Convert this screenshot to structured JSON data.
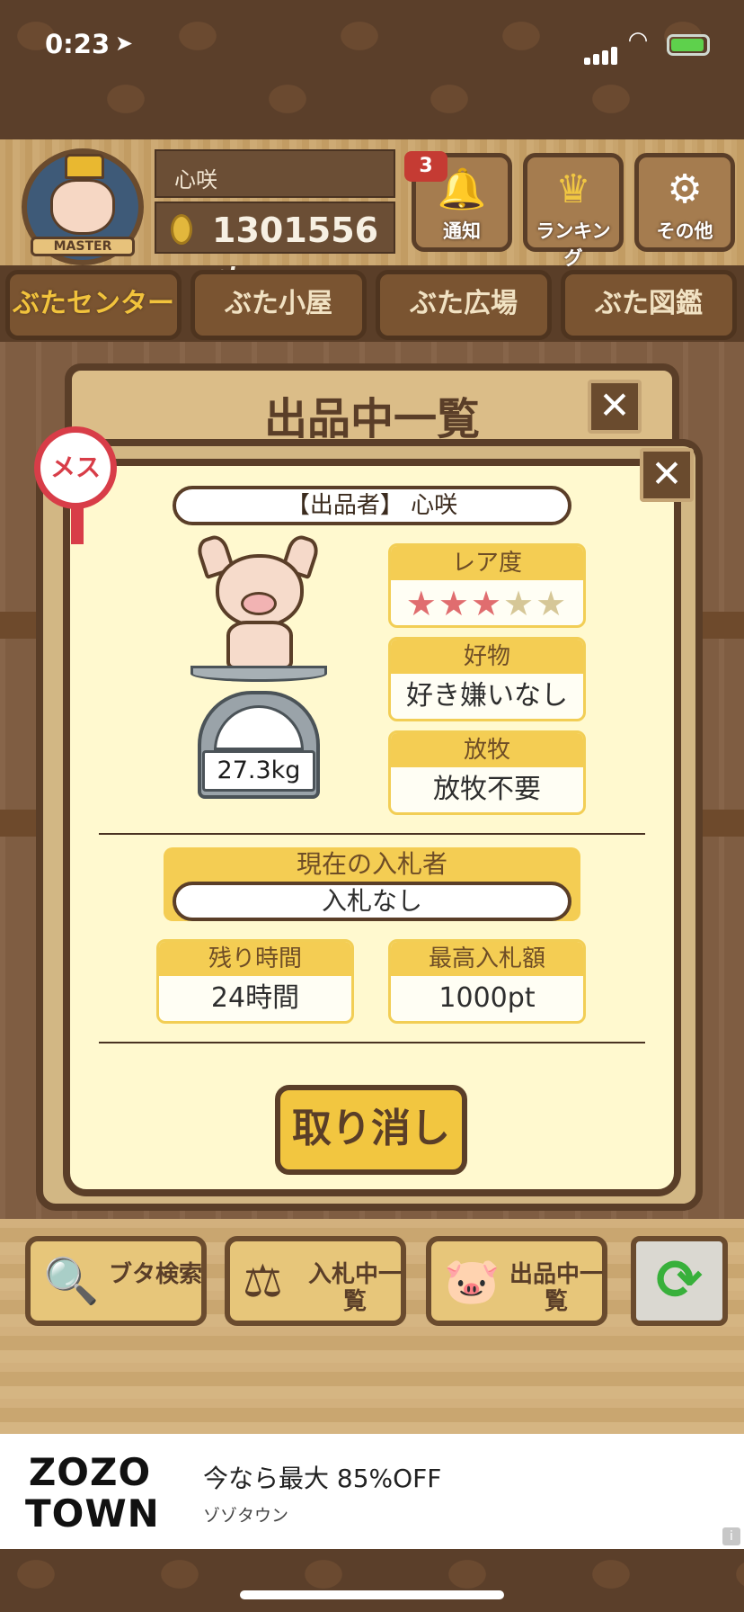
{
  "status_bar": {
    "time": "0:23"
  },
  "header": {
    "avatar_label": "MASTER",
    "user_name": "心咲",
    "points": "1301556",
    "points_unit": "pt",
    "notification_count": "3",
    "buttons": [
      {
        "label": "通知",
        "icon": "bell-icon"
      },
      {
        "label": "ランキング",
        "icon": "crown-icon"
      },
      {
        "label": "その他",
        "icon": "gear-icon"
      }
    ]
  },
  "nav": {
    "tabs": [
      {
        "label": "ぶたセンター",
        "active": true
      },
      {
        "label": "ぶた小屋",
        "active": false
      },
      {
        "label": "ぶた広場",
        "active": false
      },
      {
        "label": "ぶた図鑑",
        "active": false
      }
    ]
  },
  "modal": {
    "title": "出品中一覧",
    "gender": "メス",
    "seller": "【出品者】 心咲",
    "weight": "27.3kg",
    "rarity": {
      "label": "レア度",
      "stars_filled": 3,
      "stars_total": 5
    },
    "favorite": {
      "label": "好物",
      "value": "好き嫌いなし"
    },
    "grazing": {
      "label": "放牧",
      "value": "放牧不要"
    },
    "bidder": {
      "label": "現在の入札者",
      "value": "入札なし"
    },
    "time_left": {
      "label": "残り時間",
      "value": "24時間"
    },
    "highest_bid": {
      "label": "最高入札額",
      "value": "1000pt"
    },
    "cancel_label": "取り消し"
  },
  "bottom_bar": {
    "buttons": [
      {
        "label": "ブタ検索",
        "icon": "magnifier-icon"
      },
      {
        "label": "入札中一覧",
        "icon": "gavel-icon"
      },
      {
        "label": "出品中一覧",
        "icon": "pig-icon"
      }
    ],
    "refresh_icon": "refresh-icon"
  },
  "ad": {
    "brand_line1": "ZOZO",
    "brand_line2": "TOWN",
    "headline": "今なら最大 85%OFF",
    "subtitle": "ゾゾタウン",
    "info_label": "i"
  },
  "colors": {
    "accent_yellow": "#f4cd53",
    "frame_brown": "#5a3e28",
    "star_filled": "#e06d6f",
    "star_empty": "#d6c797",
    "gender_red": "#d83d48"
  }
}
